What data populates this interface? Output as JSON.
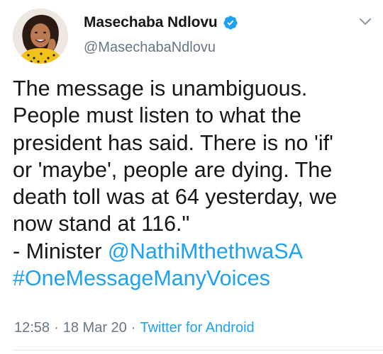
{
  "user": {
    "display_name": "Masechaba Ndlovu",
    "handle": "@MasechabaNdlovu",
    "verified": true,
    "avatar_icon": "profile-photo"
  },
  "tweet": {
    "lines": [
      "The message is unambiguous.",
      "People must listen to what the",
      "president has said. There is no 'if'",
      "or 'maybe', people are dying. The",
      "death toll was at 64 yesterday, we",
      "now stand at 116.\""
    ],
    "attribution_prefix": "- Minister ",
    "mention": "@NathiMthethwaSA",
    "hashtag": "#OneMessageManyVoices"
  },
  "meta": {
    "time": "12:58",
    "date": "18 Mar 20",
    "separator": "·",
    "source": "Twitter for Android"
  },
  "colors": {
    "accent": "#1da1f2",
    "text": "#14171a",
    "secondary": "#657786"
  }
}
